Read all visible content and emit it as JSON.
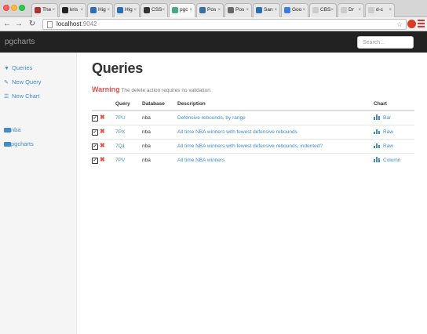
{
  "browser": {
    "tabs": [
      {
        "title": "The",
        "color": "#a33"
      },
      {
        "title": "kris",
        "color": "#222"
      },
      {
        "title": "Hig",
        "color": "#2a6fb3"
      },
      {
        "title": "Hig",
        "color": "#2a6fb3"
      },
      {
        "title": "CSS",
        "color": "#333"
      },
      {
        "title": "pgc",
        "color": "#4a8"
      },
      {
        "title": "Pos",
        "color": "#3a6ea5"
      },
      {
        "title": "Pos",
        "color": "#666"
      },
      {
        "title": "San",
        "color": "#2a6fb3"
      },
      {
        "title": "Goo",
        "color": "#3b7de0"
      },
      {
        "title": "CBS",
        "color": "#ccc"
      },
      {
        "title": "Dr",
        "color": "#ccc"
      },
      {
        "title": "d-c",
        "color": "#ccc"
      }
    ],
    "url_host": "localhost",
    "url_port": ":9042"
  },
  "navbar": {
    "brand": "pgcharts",
    "search_placeholder": "Search..."
  },
  "sidebar": {
    "items": [
      {
        "label": "Queries",
        "icon": "filter-icon"
      },
      {
        "label": "New Query",
        "icon": "pencil-icon"
      },
      {
        "label": "New Chart",
        "icon": "list-icon"
      },
      {
        "label": "nba",
        "icon": "folder-icon"
      },
      {
        "label": "pgcharts",
        "icon": "folder-icon"
      }
    ]
  },
  "main": {
    "title": "Queries",
    "warning_word": "Warning",
    "warning_text": "The delete action requires no validation.",
    "table": {
      "headers": [
        "Query",
        "Database",
        "Description",
        "Chart"
      ],
      "rows": [
        {
          "query": "7PU",
          "database": "nba",
          "description": "Defensive rebounds, by range",
          "chart": "Bar"
        },
        {
          "query": "7PX",
          "database": "nba",
          "description": "All time NBA winners with fewest defensive rebounds",
          "chart": "Raw"
        },
        {
          "query": "7Q1",
          "database": "nba",
          "description": "All time NBA winners with fewest defensive rebounds, indented?",
          "chart": "Raw"
        },
        {
          "query": "7PV",
          "database": "nba",
          "description": "All time NBA winners",
          "chart": "Column"
        }
      ]
    }
  }
}
